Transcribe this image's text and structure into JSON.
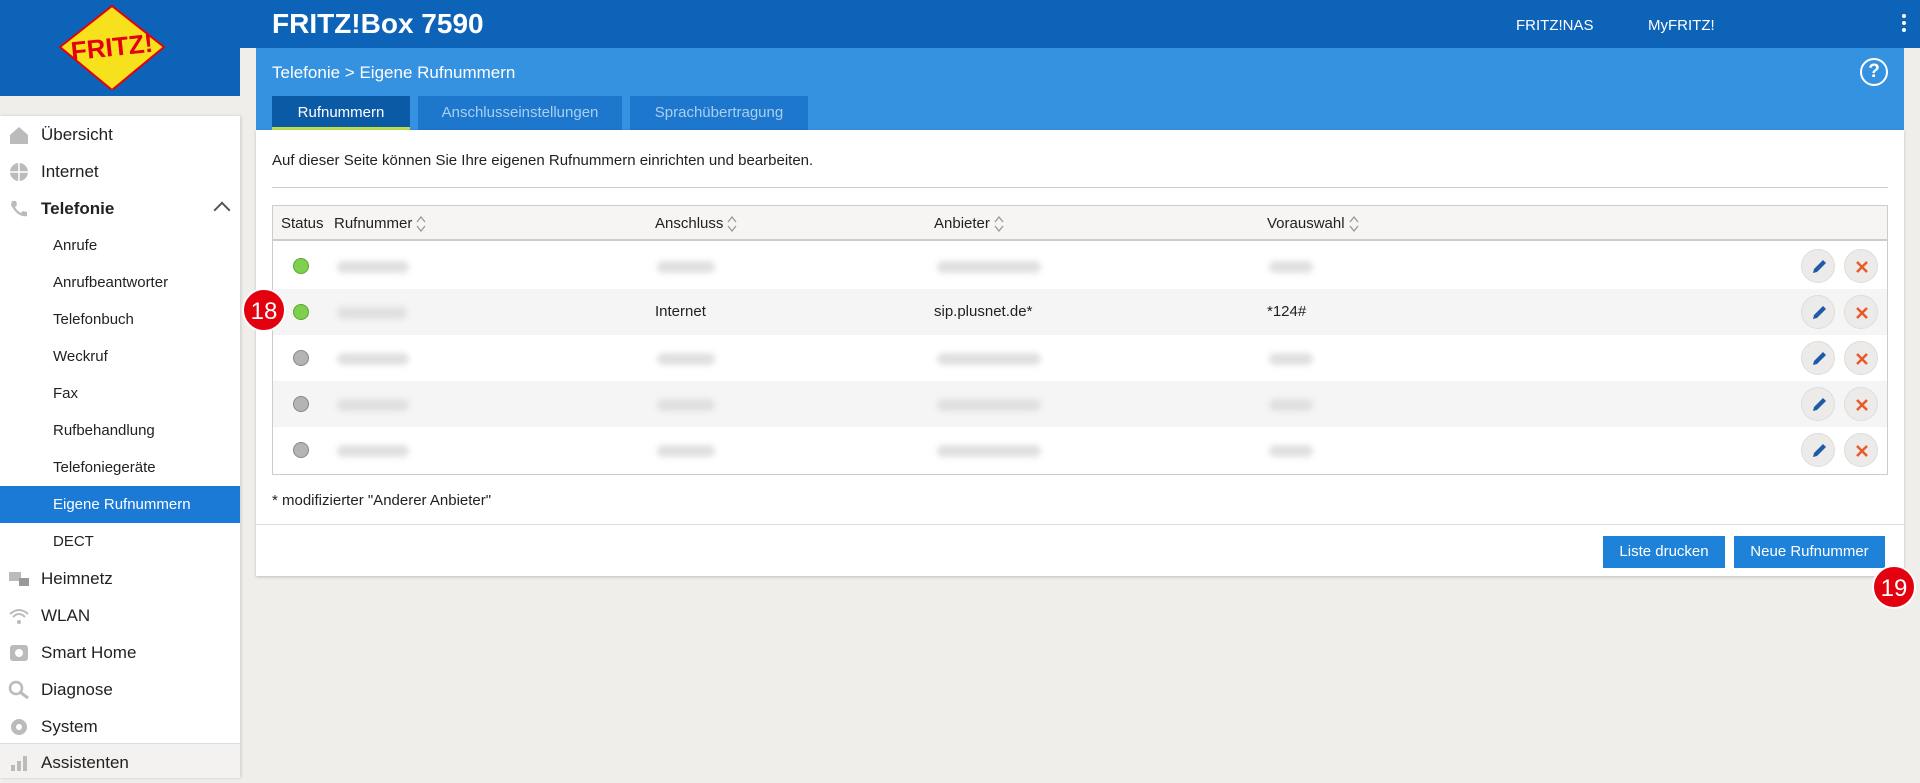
{
  "header": {
    "product_title": "FRITZ!Box 7590",
    "links": [
      "FRITZ!NAS",
      "MyFRITZ!"
    ],
    "logo_text": "FRITZ!"
  },
  "subheader": {
    "breadcrumb_parent": "Telefonie",
    "breadcrumb_separator": ">",
    "breadcrumb_current": "Eigene Rufnummern",
    "help_label": "?",
    "tabs": [
      "Rufnummern",
      "Anschlusseinstellungen",
      "Sprachübertragung"
    ]
  },
  "sidebar": {
    "items": [
      {
        "label": "Übersicht",
        "icon": "home-icon"
      },
      {
        "label": "Internet",
        "icon": "globe-icon"
      },
      {
        "label": "Telefonie",
        "icon": "phone-icon"
      },
      {
        "label": "Heimnetz",
        "icon": "network-icon"
      },
      {
        "label": "WLAN",
        "icon": "wifi-icon"
      },
      {
        "label": "Smart Home",
        "icon": "smart-home-icon"
      },
      {
        "label": "Diagnose",
        "icon": "diagnose-icon"
      },
      {
        "label": "System",
        "icon": "system-gear-icon"
      },
      {
        "label": "Assistenten",
        "icon": "assistant-icon"
      }
    ],
    "telefonie_sub": [
      "Anrufe",
      "Anrufbeantworter",
      "Telefonbuch",
      "Weckruf",
      "Fax",
      "Rufbehandlung",
      "Telefoniegeräte",
      "Eigene Rufnummern",
      "DECT"
    ],
    "active_sub": "Eigene Rufnummern"
  },
  "main": {
    "intro": "Auf dieser Seite können Sie Ihre eigenen Rufnummern einrichten und bearbeiten.",
    "table": {
      "headers": [
        "Status",
        "Rufnummer",
        "Anschluss",
        "Anbieter",
        "Vorauswahl"
      ],
      "rows": [
        {
          "status": "active",
          "rufnummer": "",
          "anschluss": "",
          "anbieter": "",
          "vorauswahl": ""
        },
        {
          "status": "active",
          "rufnummer": "",
          "anschluss": "Internet",
          "anbieter": "sip.plusnet.de*",
          "vorauswahl": "*124#"
        },
        {
          "status": "inactive",
          "rufnummer": "",
          "anschluss": "",
          "anbieter": "",
          "vorauswahl": ""
        },
        {
          "status": "inactive",
          "rufnummer": "",
          "anschluss": "",
          "anbieter": "",
          "vorauswahl": ""
        },
        {
          "status": "inactive",
          "rufnummer": "",
          "anschluss": "",
          "anbieter": "",
          "vorauswahl": ""
        }
      ]
    },
    "footnote": "* modifizierter \"Anderer Anbieter\"",
    "buttons": {
      "print": "Liste drucken",
      "new": "Neue Rufnummer"
    }
  },
  "markers": [
    "18",
    "19"
  ],
  "colors": {
    "brand_blue": "#0d63b8",
    "accent_blue": "#3592e0",
    "active_nav": "#1a7ad6",
    "status_on": "#7fd04f",
    "status_off": "#b4b4b4",
    "delete_x": "#e85a2a",
    "marker_red": "#e3000f"
  }
}
